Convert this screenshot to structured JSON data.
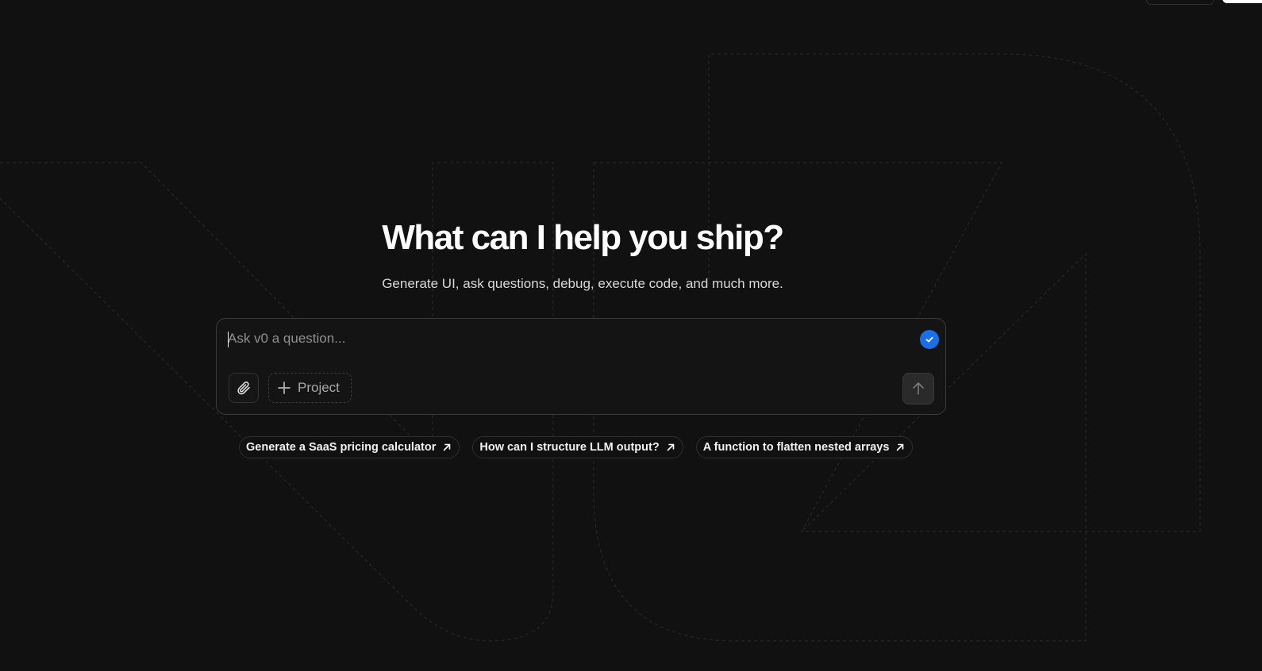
{
  "header": {
    "title": "What can I help you ship?",
    "subtitle": "Generate UI, ask questions, debug, execute code, and much more."
  },
  "prompt": {
    "placeholder": "Ask v0 a question...",
    "value": "",
    "project_label": "Project"
  },
  "suggestions": [
    {
      "label": "Generate a SaaS pricing calculator"
    },
    {
      "label": "How can I structure LLM output?"
    },
    {
      "label": "A function to flatten nested arrays"
    }
  ],
  "icons": {
    "attach": "paperclip-icon",
    "project": "plus-icon",
    "send": "arrow-up-icon",
    "verified": "check-circle-icon",
    "suggestion_arrow": "arrow-up-right-icon"
  },
  "colors": {
    "background": "#111111",
    "accent": "#1a6fe6",
    "text": "#ffffff"
  }
}
